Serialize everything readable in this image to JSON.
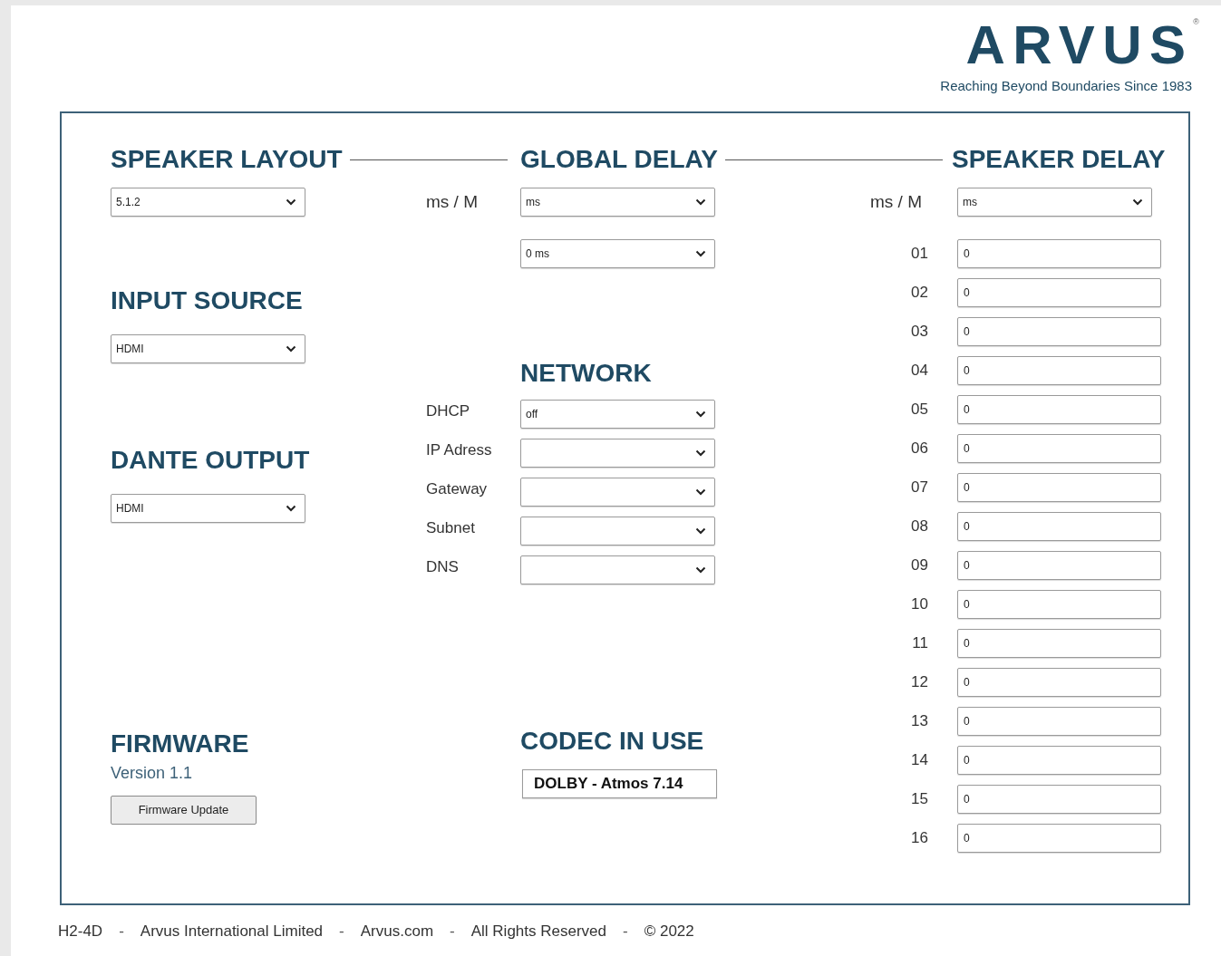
{
  "logo": {
    "wordmark": "ARVUS",
    "mark": "®",
    "tagline": "Reaching Beyond Boundaries Since 1983"
  },
  "speaker_layout": {
    "title": "SPEAKER LAYOUT",
    "value": "5.1.2"
  },
  "input_source": {
    "title": "INPUT SOURCE",
    "value": "HDMI"
  },
  "dante_output": {
    "title": "DANTE OUTPUT",
    "value": "HDMI"
  },
  "firmware": {
    "title": "FIRMWARE",
    "version": "Version 1.1",
    "button": "Firmware Update"
  },
  "global_delay": {
    "title": "GLOBAL DELAY",
    "unit_label": "ms / M",
    "unit": "ms",
    "delay": "0 ms"
  },
  "network": {
    "title": "NETWORK",
    "fields": [
      {
        "label": "DHCP",
        "value": "off"
      },
      {
        "label": "IP Adress"
      },
      {
        "label": "Gateway"
      },
      {
        "label": "Subnet"
      },
      {
        "label": "DNS"
      }
    ]
  },
  "codec": {
    "title": "CODEC IN USE",
    "value": "DOLBY - Atmos 7.14"
  },
  "speaker_delay": {
    "title": "SPEAKER DELAY",
    "unit_label": "ms / M",
    "unit": "ms",
    "channels": [
      {
        "label": "01",
        "value": "0"
      },
      {
        "label": "02",
        "value": "0"
      },
      {
        "label": "03",
        "value": "0"
      },
      {
        "label": "04",
        "value": "0"
      },
      {
        "label": "05",
        "value": "0"
      },
      {
        "label": "06",
        "value": "0"
      },
      {
        "label": "07",
        "value": "0"
      },
      {
        "label": "08",
        "value": "0"
      },
      {
        "label": "09",
        "value": "0"
      },
      {
        "label": "10",
        "value": "0"
      },
      {
        "label": "11",
        "value": "0"
      },
      {
        "label": "12",
        "value": "0"
      },
      {
        "label": "13",
        "value": "0"
      },
      {
        "label": "14",
        "value": "0"
      },
      {
        "label": "15",
        "value": "0"
      },
      {
        "label": "16",
        "value": "0"
      }
    ]
  },
  "footer": [
    {
      "kind": "text",
      "text": "H2-4D"
    },
    {
      "kind": "separator",
      "text": "-"
    },
    {
      "kind": "text",
      "text": "Arvus International Limited"
    },
    {
      "kind": "separator",
      "text": "-"
    },
    {
      "kind": "text",
      "text": "Arvus.com"
    },
    {
      "kind": "separator",
      "text": "-"
    },
    {
      "kind": "text",
      "text": "All Rights Reserved"
    },
    {
      "kind": "separator",
      "text": "-"
    },
    {
      "kind": "text",
      "text": "© 2022"
    }
  ]
}
